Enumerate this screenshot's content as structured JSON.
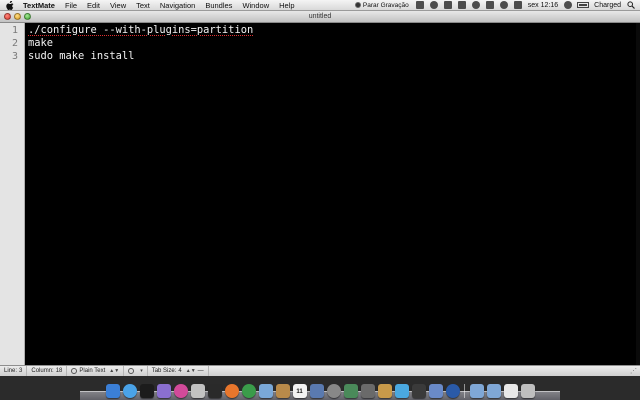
{
  "menubar": {
    "app_name": "TextMate",
    "menus": [
      "File",
      "Edit",
      "View",
      "Text",
      "Navigation",
      "Bundles",
      "Window",
      "Help"
    ],
    "status": {
      "recording_label": "Parar Gravação",
      "clock": "sex 12:16",
      "battery_label": "Charged"
    }
  },
  "window": {
    "title": "untitled"
  },
  "editor": {
    "line_numbers": [
      "1",
      "2",
      "3"
    ],
    "lines": [
      "./configure --with-plugins=partition",
      "make",
      "sudo make install"
    ]
  },
  "statusbar": {
    "line_label": "Line:",
    "line_value": "3",
    "column_label": "Column:",
    "column_value": "18",
    "language": "Plain Text",
    "tab_size_label": "Tab Size:",
    "tab_size_value": "4",
    "tab_size_extra": "—"
  },
  "dock": {
    "icons": [
      {
        "name": "finder-icon",
        "color": "#3b7fd6"
      },
      {
        "name": "safari-icon",
        "color": "#4aa3e8"
      },
      {
        "name": "terminal-icon",
        "color": "#1c1c1c"
      },
      {
        "name": "itunes-icon",
        "color": "#8a6fd0"
      },
      {
        "name": "app-store-icon",
        "color": "#d24a9a"
      },
      {
        "name": "photo-booth-icon",
        "color": "#c2c2c2"
      },
      {
        "name": "app-icon",
        "color": "#2a2a2a"
      },
      {
        "name": "firefox-icon",
        "color": "#e8762c"
      },
      {
        "name": "chrome-icon",
        "color": "#3a9c4a"
      },
      {
        "name": "mail-icon",
        "color": "#7aa8d8"
      },
      {
        "name": "address-book-icon",
        "color": "#b88a4a"
      },
      {
        "name": "calendar-icon",
        "color": "#f2f2f2",
        "text": "11"
      },
      {
        "name": "xcode-icon",
        "color": "#5a7ab0"
      },
      {
        "name": "music-icon",
        "color": "#888888"
      },
      {
        "name": "app-icon",
        "color": "#4a8a5a"
      },
      {
        "name": "utility-icon",
        "color": "#6a6a6a"
      },
      {
        "name": "package-icon",
        "color": "#c89a4a"
      },
      {
        "name": "twitter-icon",
        "color": "#4aa8e0"
      },
      {
        "name": "camera-icon",
        "color": "#3a3a3a"
      },
      {
        "name": "preview-icon",
        "color": "#6a8ac8"
      },
      {
        "name": "search-icon",
        "color": "#2a5aa8"
      },
      {
        "name": "applications-folder-icon",
        "color": "#7fa7d6"
      },
      {
        "name": "documents-folder-icon",
        "color": "#7fa7d6"
      },
      {
        "name": "file-icon",
        "color": "#e8e8e8"
      },
      {
        "name": "trash-icon",
        "color": "#bfbfbf"
      }
    ]
  }
}
